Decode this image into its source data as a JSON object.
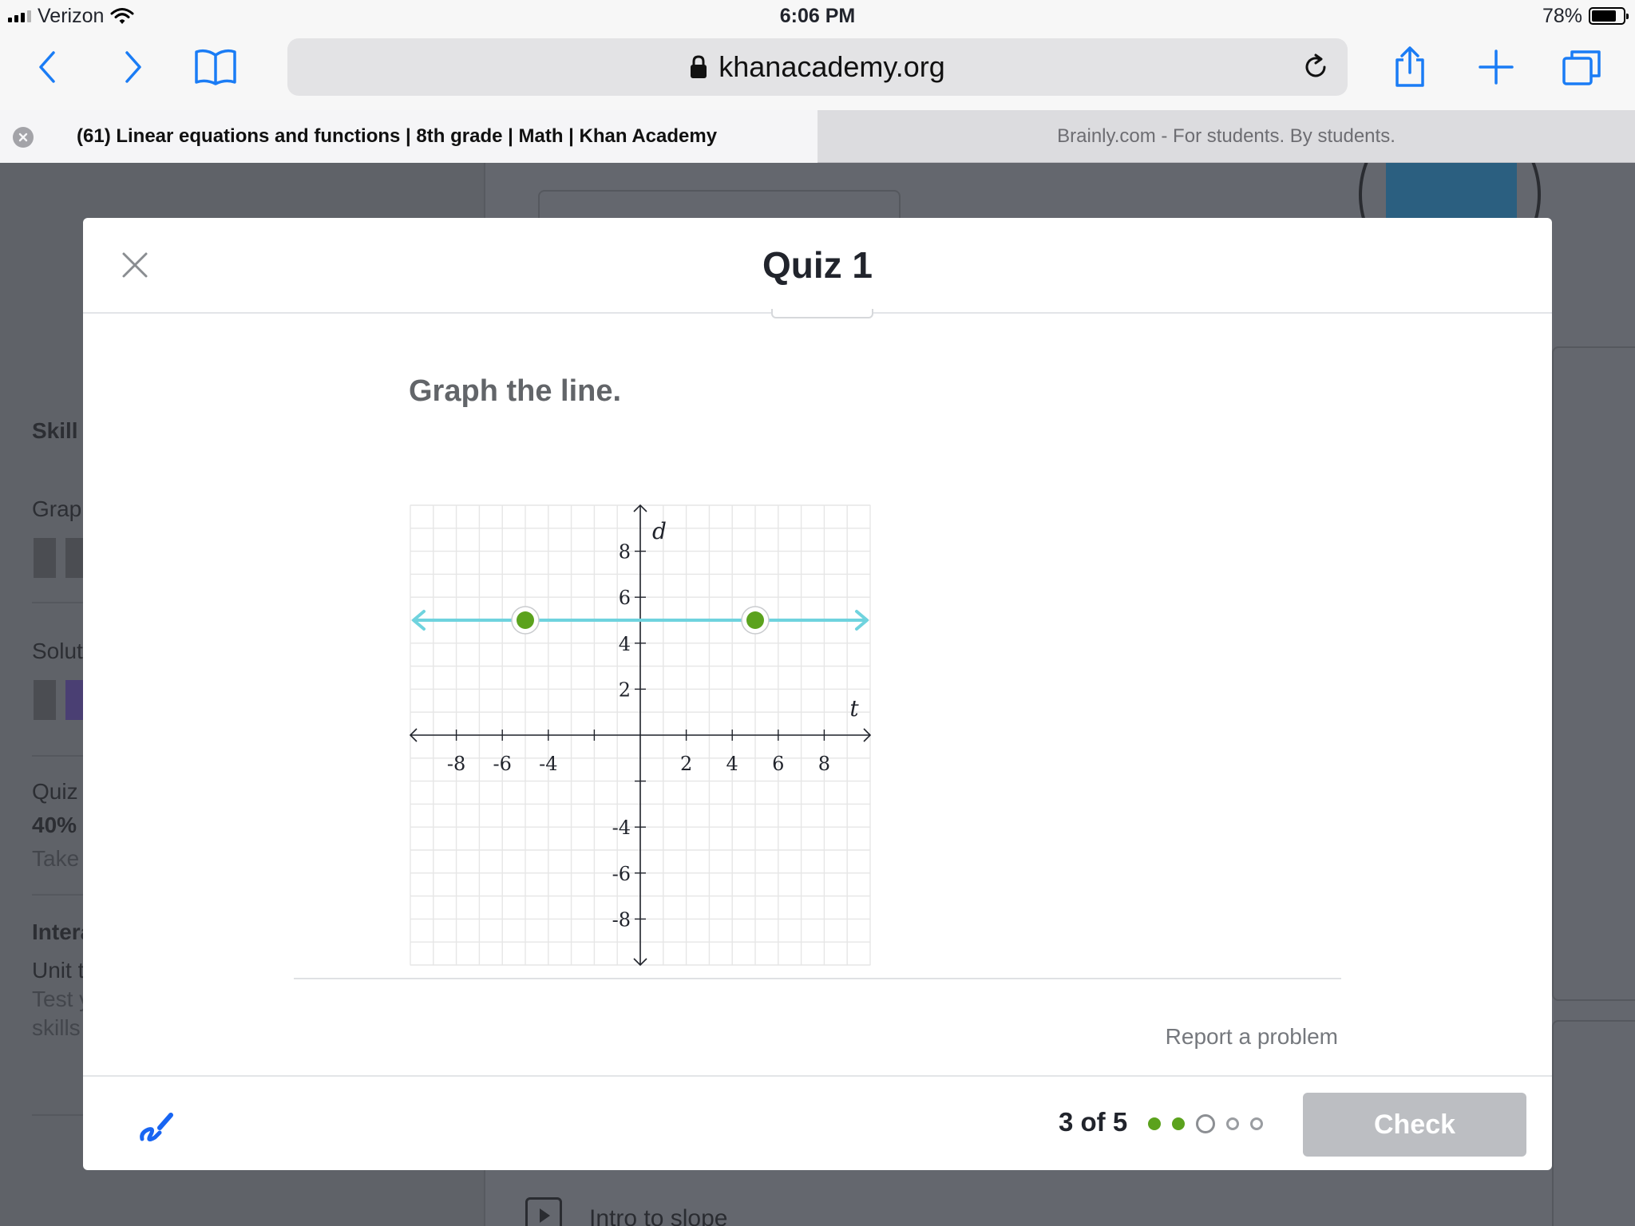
{
  "status_bar": {
    "carrier": "Verizon",
    "time": "6:06 PM",
    "battery": "78%",
    "battery_level": 0.78
  },
  "browser": {
    "url": "khanacademy.org",
    "tabs": [
      {
        "title": "(61) Linear equations and functions | 8th grade | Math | Khan Academy",
        "active": true
      },
      {
        "title": "Brainly.com - For students. By students.",
        "active": false
      }
    ],
    "icons": [
      "back-icon",
      "forward-icon",
      "bookmarks-icon",
      "lock-icon",
      "reload-icon",
      "share-icon",
      "new-tab-icon",
      "tabs-icon"
    ]
  },
  "background_page": {
    "sidebar": {
      "skill_heading": "Skill",
      "item1": "Grapl",
      "item2": "Solut",
      "quiz_label": "Quiz",
      "quiz_percent": "40%",
      "quiz_action": "Take",
      "interactive_heading": "Intera",
      "unit_label": "Unit t",
      "unit_desc1": "Test y",
      "unit_desc2": "skills"
    },
    "bottom_item": "Intro to slope"
  },
  "modal": {
    "title": "Quiz 1",
    "question": "Graph the line.",
    "report_link": "Report a problem",
    "progress": {
      "text": "3 of 5",
      "current": 3,
      "total": 5,
      "completed": 2
    },
    "check_label": "Check",
    "colors": {
      "line": "#6fd3de",
      "point": "#5ba21d",
      "check_disabled": "#bcbec2"
    }
  },
  "chart_data": {
    "type": "line",
    "xlabel": "t",
    "ylabel": "d",
    "xlim": [
      -10,
      10
    ],
    "ylim": [
      -10,
      10
    ],
    "x_ticks": [
      -8,
      -6,
      -4,
      2,
      4,
      6,
      8
    ],
    "y_ticks": [
      8,
      6,
      4,
      2,
      -4,
      -6,
      -8
    ],
    "grid": true,
    "points": [
      {
        "x": -5,
        "y": 5
      },
      {
        "x": 5,
        "y": 5
      }
    ],
    "line": {
      "slope": 0,
      "intercept": 5
    }
  }
}
